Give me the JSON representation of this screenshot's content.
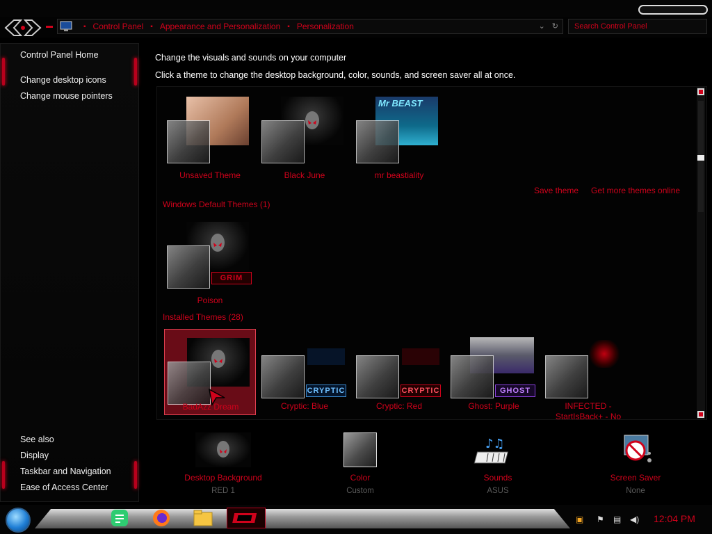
{
  "address": {
    "crumbs": [
      "Control Panel",
      "Appearance and Personalization",
      "Personalization"
    ],
    "search_placeholder": "Search Control Panel"
  },
  "sidebar": {
    "home": "Control Panel Home",
    "tasks": [
      "Change desktop icons",
      "Change mouse pointers"
    ],
    "see_also_title": "See also",
    "see_also": [
      "Display",
      "Taskbar and Navigation",
      "Ease of Access Center"
    ]
  },
  "main": {
    "heading": "Change the visuals and sounds on your computer",
    "subheading": "Click a theme to change the desktop background, color, sounds, and screen saver all at once."
  },
  "themes": {
    "my_themes": [
      "Unsaved Theme",
      "Black June",
      "mr beastiality"
    ],
    "wall_caption": "Mr BEAST",
    "save_theme": "Save theme",
    "get_more": "Get more themes online",
    "default_title": "Windows Default Themes (1)",
    "default_themes": [
      {
        "label": "Poison",
        "badge": "GRIM"
      }
    ],
    "installed_title": "Installed Themes (28)",
    "installed": [
      {
        "label": "BadAzz Dream",
        "badge": "",
        "selected": true
      },
      {
        "label": "Cryptic: Blue",
        "badge": "CRYPTIC"
      },
      {
        "label": "Cryptic: Red",
        "badge": "CRYPTIC"
      },
      {
        "label": "Ghost: Purple",
        "badge": "GHOST"
      },
      {
        "label": "INFECTED - StartIsBack+ - No"
      }
    ]
  },
  "options": [
    {
      "label": "Desktop Background",
      "value": "RED 1"
    },
    {
      "label": "Color",
      "value": "Custom"
    },
    {
      "label": "Sounds",
      "value": "ASUS"
    },
    {
      "label": "Screen Saver",
      "value": "None"
    }
  ],
  "taskbar": {
    "clock": "12:04 PM"
  },
  "colors": {
    "accent": "#d0021b",
    "background": "#000000"
  }
}
